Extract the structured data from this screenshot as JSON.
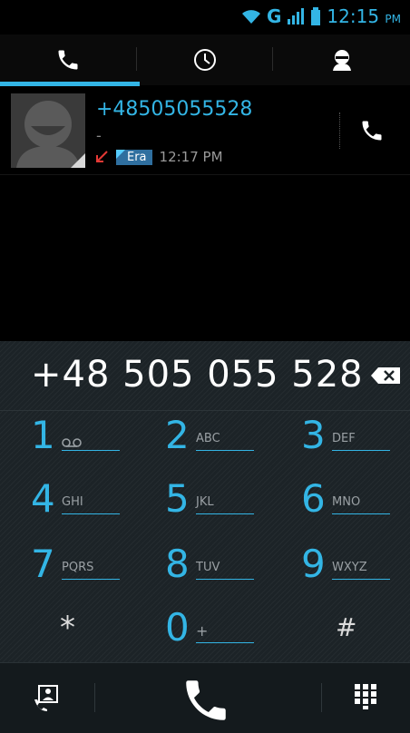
{
  "status_bar": {
    "network": "G",
    "time": "12:15",
    "ampm": "PM"
  },
  "tabs": [
    {
      "name": "phone",
      "active": true
    },
    {
      "name": "recent",
      "active": false
    },
    {
      "name": "contacts",
      "active": false
    }
  ],
  "call_log": {
    "number": "+48505055528",
    "label": "-",
    "sim": "Era",
    "time": "12:17 PM"
  },
  "dialer": {
    "digits": "+48 505 055 528",
    "keys": [
      {
        "num": "1",
        "letters": "oo"
      },
      {
        "num": "2",
        "letters": "ABC"
      },
      {
        "num": "3",
        "letters": "DEF"
      },
      {
        "num": "4",
        "letters": "GHI"
      },
      {
        "num": "5",
        "letters": "JKL"
      },
      {
        "num": "6",
        "letters": "MNO"
      },
      {
        "num": "7",
        "letters": "PQRS"
      },
      {
        "num": "8",
        "letters": "TUV"
      },
      {
        "num": "9",
        "letters": "WXYZ"
      },
      {
        "num": "*",
        "letters": ""
      },
      {
        "num": "0",
        "letters": "+"
      },
      {
        "num": "#",
        "letters": ""
      }
    ]
  },
  "colors": {
    "accent": "#33b5e5",
    "background": "#000000",
    "dialpad": "#1c2327"
  }
}
